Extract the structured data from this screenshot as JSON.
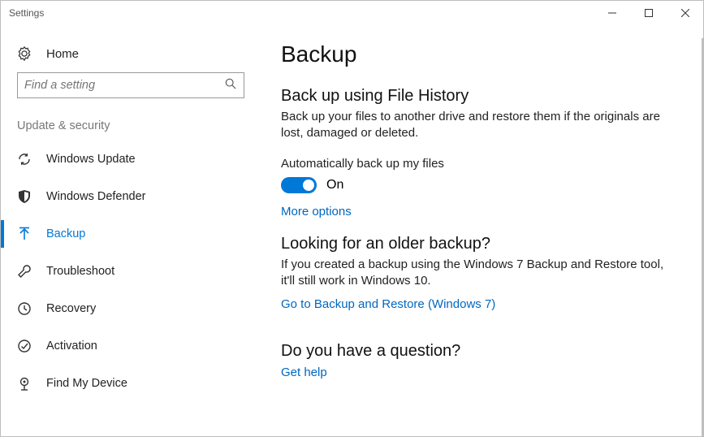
{
  "window": {
    "title": "Settings"
  },
  "sidebar": {
    "home": "Home",
    "search_placeholder": "Find a setting",
    "group": "Update & security",
    "items": [
      {
        "label": "Windows Update"
      },
      {
        "label": "Windows Defender"
      },
      {
        "label": "Backup"
      },
      {
        "label": "Troubleshoot"
      },
      {
        "label": "Recovery"
      },
      {
        "label": "Activation"
      },
      {
        "label": "Find My Device"
      }
    ]
  },
  "main": {
    "title": "Backup",
    "fh_heading": "Back up using File History",
    "fh_desc": "Back up your files to another drive and restore them if the originals are lost, damaged or deleted.",
    "auto_label": "Automatically back up my files",
    "toggle_state": "On",
    "more_options": "More options",
    "older_heading": "Looking for an older backup?",
    "older_desc": "If you created a backup using the Windows 7 Backup and Restore tool, it'll still work in Windows 10.",
    "older_link": "Go to Backup and Restore (Windows 7)",
    "question_heading": "Do you have a question?",
    "get_help": "Get help"
  }
}
